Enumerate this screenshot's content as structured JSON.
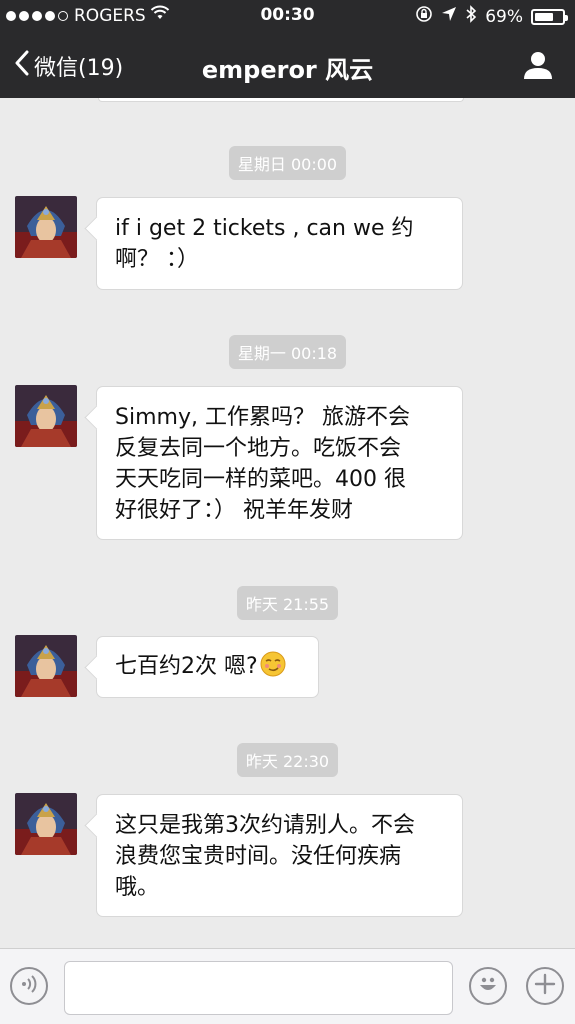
{
  "status_bar": {
    "carrier": "ROGERS",
    "time": "00:30",
    "battery": "69%",
    "battery_level": 0.69
  },
  "nav": {
    "back_label": "微信(19)",
    "title": "emperor 风云"
  },
  "messages": [
    {
      "timestamp": "星期日 00:00",
      "text": "if i get 2 tickets , can we 约\n啊？ ：）"
    },
    {
      "timestamp": "星期一 00:18",
      "text": "Simmy, 工作累吗？ 旅游不会\n反复去同一个地方。吃饭不会\n天天吃同一样的菜吧。400 很\n好很好了：） 祝羊年发财"
    },
    {
      "timestamp": "昨天 21:55",
      "text": "七百约2次 嗯?",
      "emoji": "smirk-emoji"
    },
    {
      "timestamp": "昨天 22:30",
      "text": "这只是我第3次约请别人。不会\n浪费您宝贵时间。没任何疾病\n哦。"
    }
  ],
  "colors": {
    "nav_bg": "#2a2a2c",
    "chat_bg": "#ebebeb",
    "timestamp_bg": "#cfcfcf"
  },
  "icons": [
    "signal-dots-icon",
    "wifi-icon",
    "lock-rotation-icon",
    "location-icon",
    "bluetooth-icon",
    "battery-icon",
    "back-chevron-icon",
    "profile-icon",
    "voice-icon",
    "emoji-icon",
    "plus-icon"
  ]
}
